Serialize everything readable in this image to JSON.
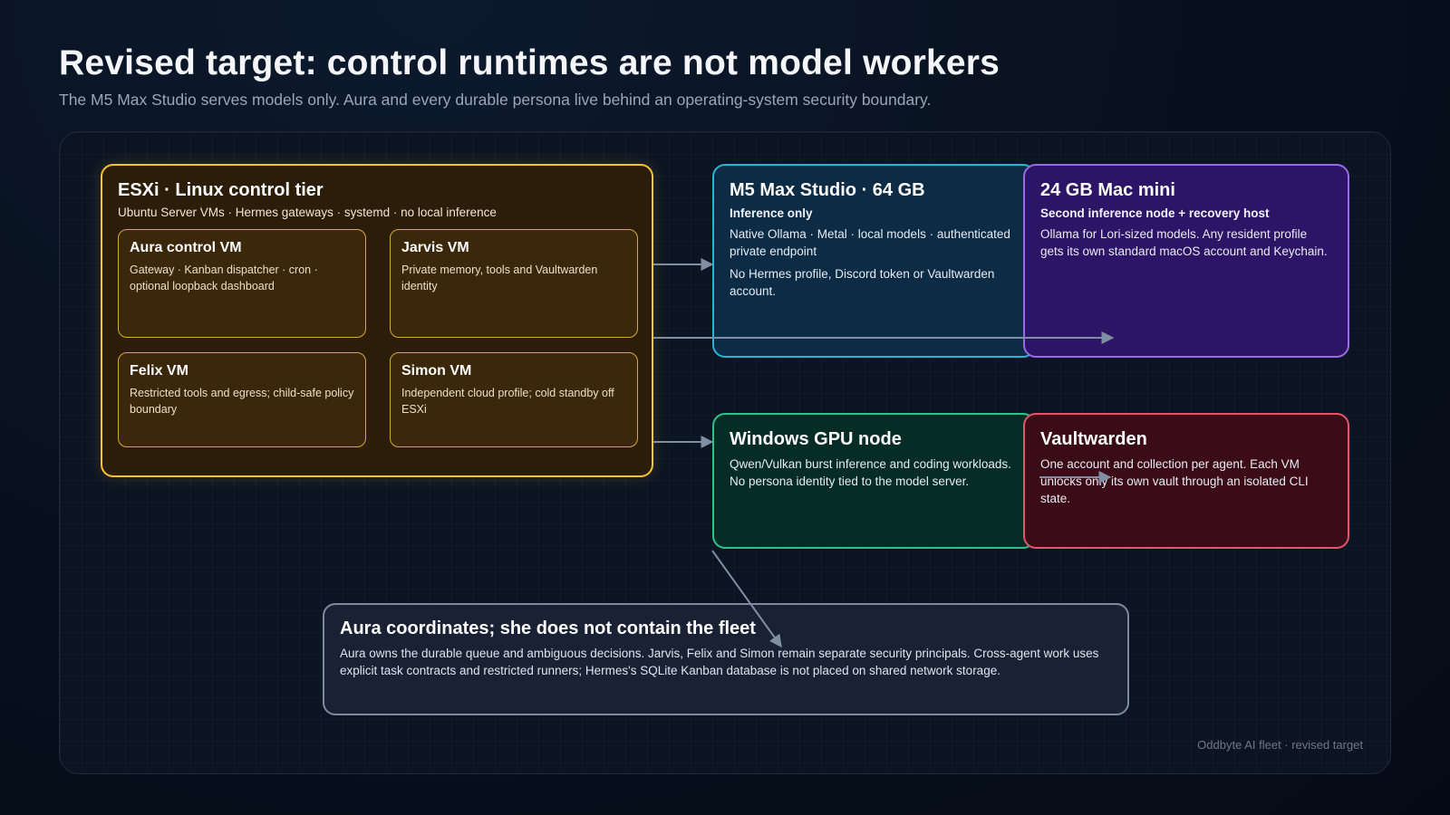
{
  "header": {
    "title": "Revised target: control runtimes are not model workers",
    "subtitle": "The M5 Max Studio serves models only. Aura and every durable persona live behind an operating-system security boundary."
  },
  "esxi": {
    "title": "ESXi · Linux control tier",
    "subtitle": "Ubuntu Server VMs · Hermes gateways · systemd · no local inference",
    "vms": [
      {
        "title": "Aura control VM",
        "text": "Gateway · Kanban dispatcher · cron · optional loopback dashboard"
      },
      {
        "title": "Jarvis VM",
        "text": "Private memory, tools and Vaultwarden identity"
      },
      {
        "title": "Felix VM",
        "text": "Restricted tools and egress; child-safe policy boundary"
      },
      {
        "title": "Simon VM",
        "text": "Independent cloud profile; cold standby off ESXi"
      }
    ]
  },
  "m5": {
    "title": "M5 Max Studio · 64 GB",
    "tag": "Inference only",
    "text1": "Native Ollama · Metal · local models · authenticated private endpoint",
    "text2": "No Hermes profile, Discord token or Vaultwarden account."
  },
  "mini": {
    "title": "24 GB Mac mini",
    "tag": "Second inference node + recovery host",
    "text": "Ollama for Lori-sized models. Any resident profile gets its own standard macOS account and Keychain."
  },
  "windows": {
    "title": "Windows GPU node",
    "text": "Qwen/Vulkan burst inference and coding workloads. No persona identity tied to the model server."
  },
  "vault": {
    "title": "Vaultwarden",
    "text": "One account and collection per agent. Each VM unlocks only its own vault through an isolated CLI state."
  },
  "aura_note": {
    "title": "Aura coordinates; she does not contain the fleet",
    "text": "Aura owns the durable queue and ambiguous decisions. Jarvis, Felix and Simon remain separate security principals. Cross-agent work uses explicit task contracts and restricted runners; Hermes's SQLite Kanban database is not placed on shared network storage."
  },
  "footer": "Oddbyte AI fleet · revised target",
  "colors": {
    "esxi": "#f4c430",
    "m5": "#27b5d6",
    "mini": "#9c6ae8",
    "windows": "#2ec489",
    "vault": "#e2566b",
    "arrow": "#7f8ea3"
  }
}
